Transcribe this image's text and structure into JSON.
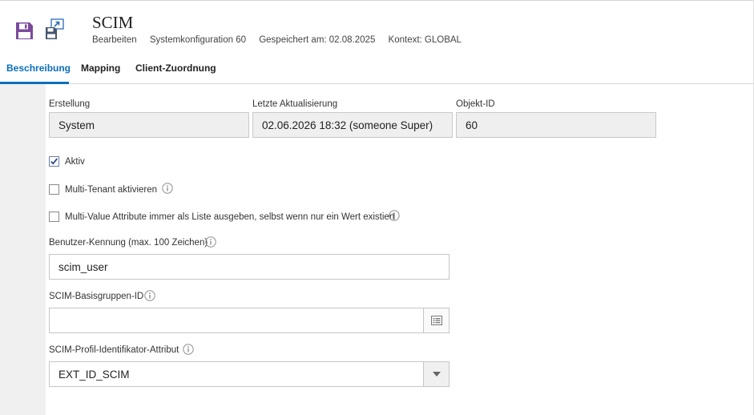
{
  "header": {
    "title": "SCIM",
    "meta": {
      "mode": "Bearbeiten",
      "config": "Systemkonfiguration 60",
      "saved": "Gespeichert am: 02.08.2025",
      "context": "Kontext: GLOBAL"
    }
  },
  "tabs": [
    {
      "label": "Beschreibung",
      "active": true
    },
    {
      "label": "Mapping",
      "active": false
    },
    {
      "label": "Client-Zuordnung",
      "active": false
    }
  ],
  "info": {
    "created_label": "Erstellung",
    "created_value": "System",
    "updated_label": "Letzte Aktualisierung",
    "updated_value": "02.06.2026 18:32 (someone Super)",
    "object_id_label": "Objekt-ID",
    "object_id_value": "60"
  },
  "checkboxes": {
    "active": {
      "label": "Aktiv",
      "checked": true
    },
    "multi_tenant": {
      "label": "Multi-Tenant aktivieren",
      "checked": false
    },
    "multi_value": {
      "label": "Multi-Value Attribute immer als Liste ausgeben, selbst wenn nur ein Wert existiert",
      "checked": false
    }
  },
  "fields": {
    "user_id": {
      "label": "Benutzer-Kennung (max. 100 Zeichen)",
      "value": "scim_user"
    },
    "base_group": {
      "label": "SCIM-Basisgruppen-ID",
      "value": ""
    },
    "profile_attr": {
      "label": "SCIM-Profil-Identifikator-Attribut",
      "value": "EXT_ID_SCIM"
    }
  },
  "colors": {
    "accent": "#0a6ebd",
    "save_icon": "#7b4a9c"
  }
}
